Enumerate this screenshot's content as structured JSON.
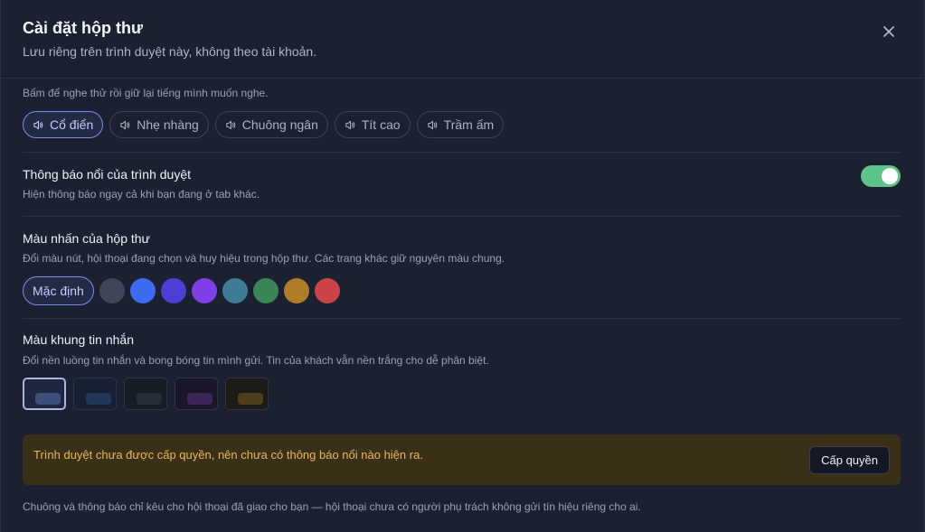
{
  "header": {
    "title": "Cài đặt hộp thư",
    "subtitle": "Lưu riêng trên trình duyệt này, không theo tài khoản."
  },
  "sound": {
    "hint": "Bấm để nghe thử rồi giữ lại tiếng mình muốn nghe.",
    "options": [
      "Cổ điển",
      "Nhẹ nhàng",
      "Chuông ngân",
      "Tít cao",
      "Trầm ấm"
    ],
    "selected": "Cổ điển"
  },
  "notifications": {
    "title": "Thông báo nổi của trình duyệt",
    "hint": "Hiện thông báo ngay cả khi bạn đang ở tab khác.",
    "enabled": true
  },
  "accent": {
    "title": "Màu nhấn của hộp thư",
    "hint": "Đổi màu nút, hội thoại đang chọn và huy hiệu trong hộp thư. Các trang khác giữ nguyên màu chung.",
    "default_label": "Mặc định",
    "colors": [
      "#3e4658",
      "#3d6cf0",
      "#4b3fd6",
      "#7e3fe6",
      "#3f7c95",
      "#3a8556",
      "#b07d27",
      "#cc4448"
    ]
  },
  "bubble": {
    "title": "Màu khung tin nhắn",
    "hint": "Đổi nền luồng tin nhắn và bong bóng tin mình gửi. Tin của khách vẫn nền trắng cho dễ phân biệt.",
    "options": [
      {
        "bg": "#1f2740",
        "pill": "#3d4f7a"
      },
      {
        "bg": "#172033",
        "pill": "#23365a"
      },
      {
        "bg": "#171b24",
        "pill": "#272d38"
      },
      {
        "bg": "#1a1628",
        "pill": "#3a2758"
      },
      {
        "bg": "#1b1a15",
        "pill": "#4d3f1c"
      }
    ]
  },
  "banner": {
    "text": "Trình duyệt chưa được cấp quyền, nên chưa có thông báo nổi nào hiện ra.",
    "button": "Cấp quyền"
  },
  "footer_note": "Chuông và thông báo chỉ kêu cho hội thoại đã giao cho bạn — hội thoại chưa có người phụ trách không gửi tín hiệu riêng cho ai."
}
